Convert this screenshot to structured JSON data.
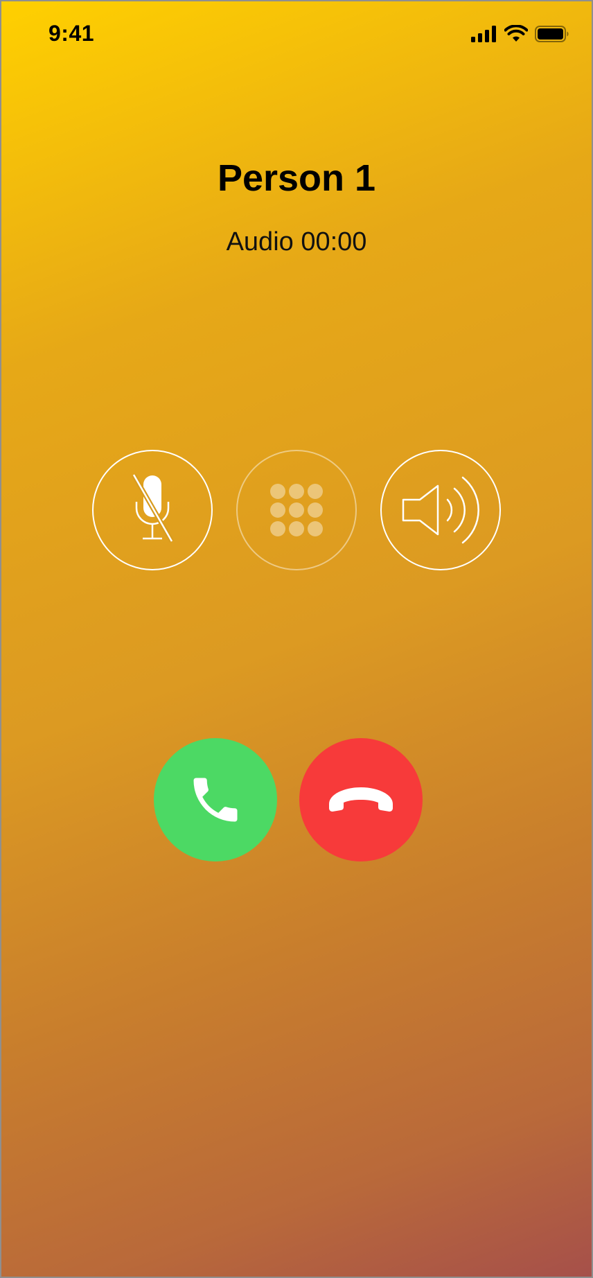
{
  "status_bar": {
    "time": "9:41",
    "icons": [
      "cellular-signal-icon",
      "wifi-icon",
      "battery-icon"
    ]
  },
  "caller": {
    "name": "Person 1",
    "status": "Audio 00:00"
  },
  "controls": [
    {
      "name": "mute",
      "icon": "microphone-muted-icon"
    },
    {
      "name": "keypad",
      "icon": "keypad-icon",
      "disabled": true
    },
    {
      "name": "speaker",
      "icon": "speaker-icon"
    }
  ],
  "actions": {
    "accept_icon": "phone-icon",
    "decline_icon": "phone-hangup-icon"
  },
  "colors": {
    "accept": "#4cd964",
    "decline": "#f73a3a",
    "gradient_top": "#ffd000",
    "gradient_bottom": "#a6504a"
  }
}
